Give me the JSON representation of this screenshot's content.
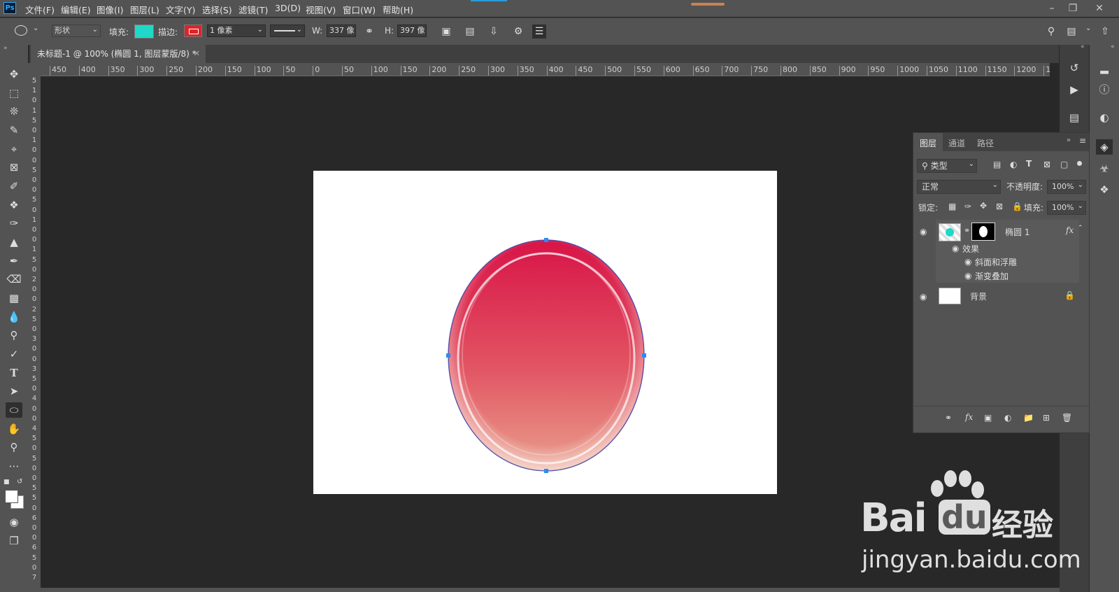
{
  "app": {
    "logo": "Ps"
  },
  "menu": [
    "文件(F)",
    "编辑(E)",
    "图像(I)",
    "图层(L)",
    "文字(Y)",
    "选择(S)",
    "滤镜(T)",
    "3D(D)",
    "视图(V)",
    "窗口(W)",
    "帮助(H)"
  ],
  "options": {
    "mode": "形状",
    "fill_label": "填充:",
    "fill_color": "#1fd8c8",
    "stroke_label": "描边:",
    "stroke_color": "#d9262b",
    "stroke_width": "1 像素",
    "w_label": "W:",
    "w_value": "337 像",
    "h_label": "H:",
    "h_value": "397 像"
  },
  "document": {
    "tab_title": "未标题-1 @ 100% (椭圆 1, 图层蒙版/8) *"
  },
  "rulers": {
    "h_labels": [
      "450",
      "400",
      "350",
      "300",
      "250",
      "200",
      "150",
      "100",
      "50",
      "0",
      "50",
      "100",
      "150",
      "200",
      "250",
      "300",
      "350",
      "400",
      "450",
      "500",
      "550",
      "600",
      "650",
      "700",
      "750",
      "800",
      "850",
      "900",
      "950",
      "1000",
      "1050",
      "1100",
      "1150",
      "1200",
      "1"
    ],
    "v_labels": [
      "5",
      "1",
      "0",
      "1",
      "5",
      "0",
      "1",
      "0",
      "0",
      "5",
      "0",
      "0",
      "5",
      "0",
      "1",
      "0",
      "0",
      "1",
      "5",
      "0",
      "2",
      "0",
      "0",
      "2",
      "5",
      "0",
      "3",
      "0",
      "0",
      "3",
      "5",
      "0",
      "4",
      "0",
      "0",
      "4",
      "5",
      "0",
      "5",
      "0",
      "0",
      "5",
      "5",
      "0",
      "6",
      "0",
      "0",
      "6",
      "5",
      "0",
      "7"
    ]
  },
  "layers_panel": {
    "tabs": [
      "图层",
      "通道",
      "路径"
    ],
    "filter_kind": "类型",
    "blend_mode": "正常",
    "opacity_label": "不透明度:",
    "opacity_value": "100%",
    "lock_label": "锁定:",
    "fill_label": "填充:",
    "fill_value": "100%",
    "layers": [
      {
        "name": "椭圆 1",
        "fx": "fx",
        "effects_label": "效果",
        "effects": [
          "斜面和浮雕",
          "渐变叠加"
        ]
      },
      {
        "name": "背景"
      }
    ]
  },
  "watermark": {
    "brand": "Bai",
    "brand2": "du",
    "cn": "经验",
    "url": "jingyan.baidu.com"
  }
}
